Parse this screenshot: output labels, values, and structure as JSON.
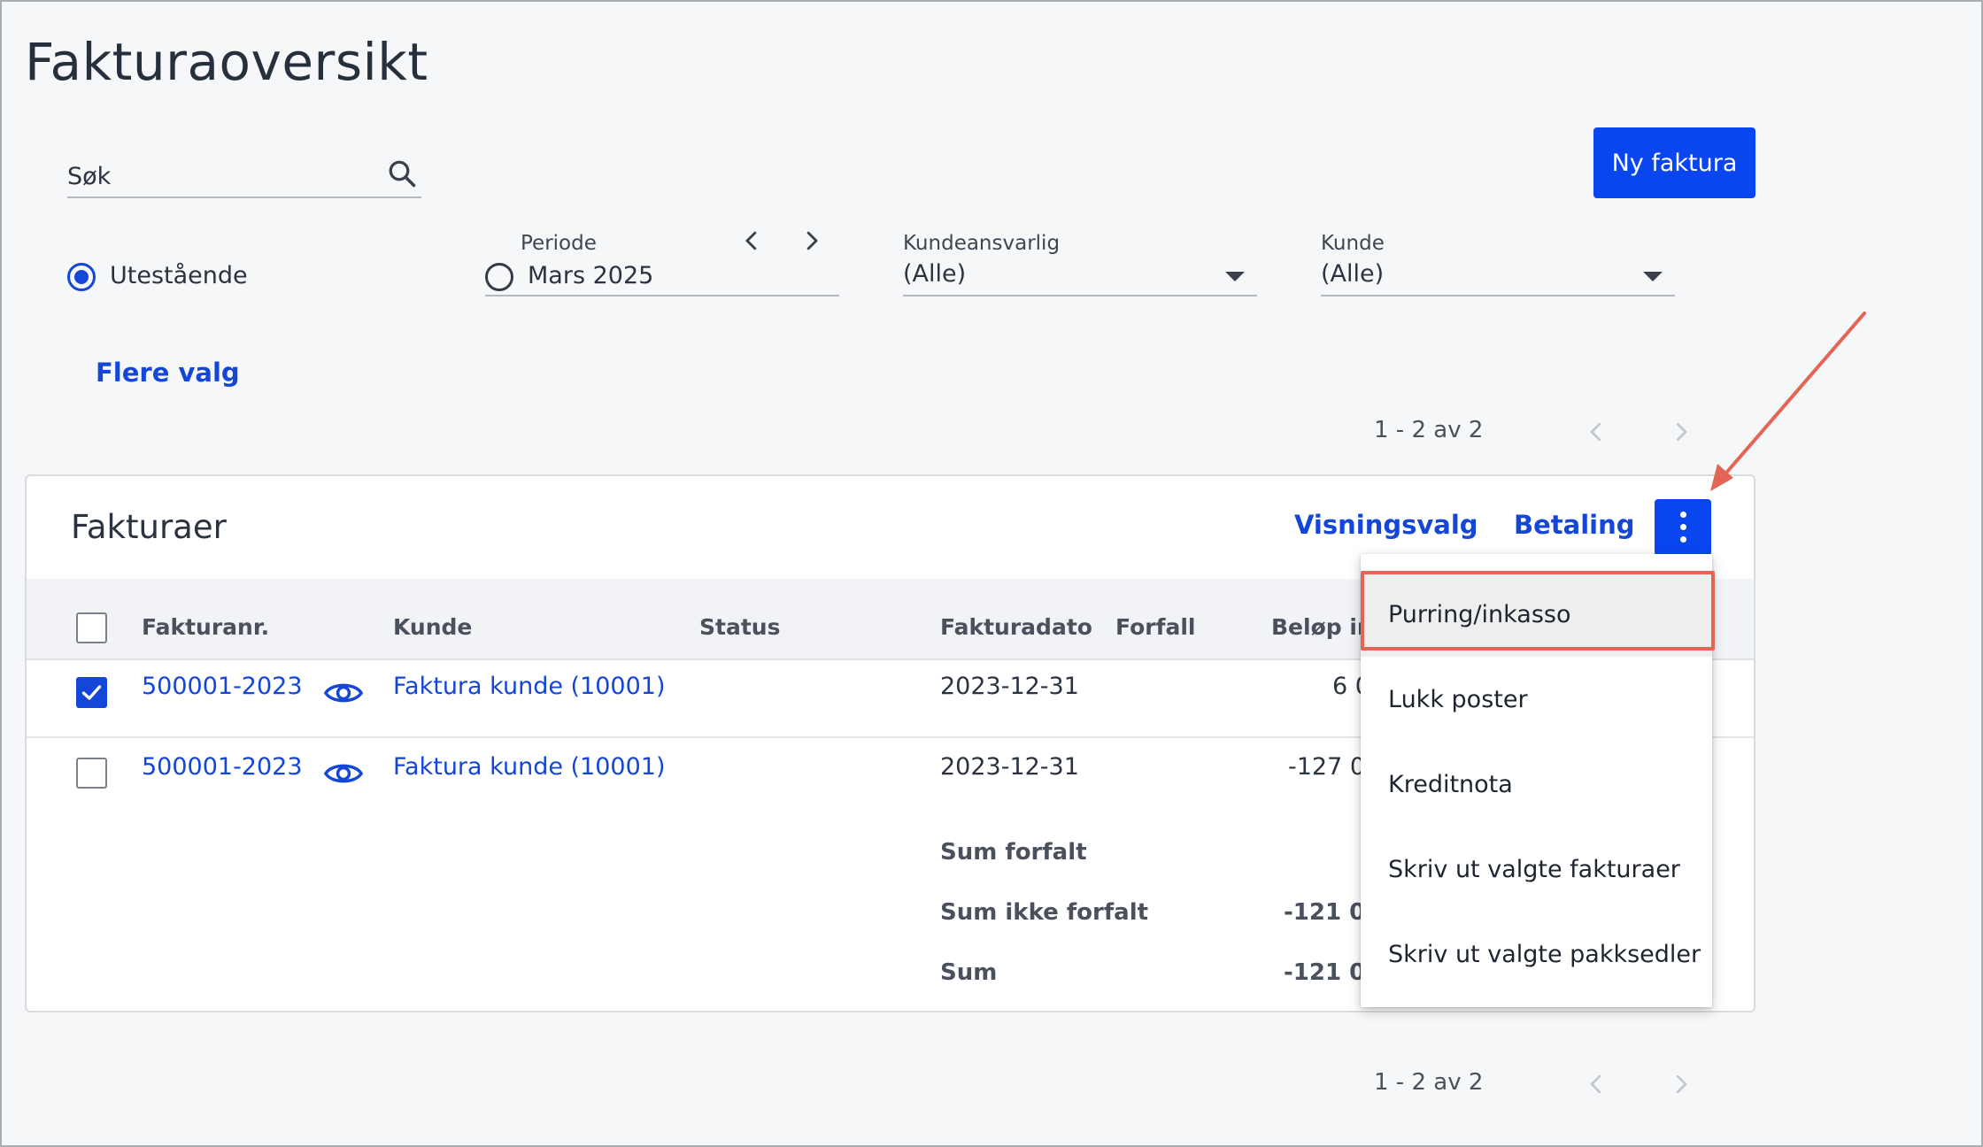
{
  "page": {
    "title": "Fakturaoversikt"
  },
  "search": {
    "label": "Søk"
  },
  "actions": {
    "new_invoice": "Ny faktura"
  },
  "filters": {
    "outstanding_label": "Utestående",
    "period": {
      "label": "Periode",
      "value": "Mars 2025"
    },
    "account_manager": {
      "label": "Kundeansvarlig",
      "value": "(Alle)"
    },
    "customer": {
      "label": "Kunde",
      "value": "(Alle)"
    },
    "more_options": "Flere valg"
  },
  "pagination": {
    "top_text": "1 - 2 av 2",
    "bottom_text": "1 - 2 av 2"
  },
  "card": {
    "title": "Fakturaer",
    "view_options": "Visningsvalg",
    "payment": "Betaling"
  },
  "table": {
    "columns": [
      "Fakturanr.",
      "Kunde",
      "Status",
      "Fakturadato",
      "Forfall",
      "Beløp in"
    ],
    "rows": [
      {
        "checked": true,
        "invoice_no": "500001-2023",
        "customer": "Faktura kunde (10001)",
        "status": "",
        "invoice_date": "2023-12-31",
        "due": "",
        "amount": "6 0"
      },
      {
        "checked": false,
        "invoice_no": "500001-2023",
        "customer": "Faktura kunde (10001)",
        "status": "",
        "invoice_date": "2023-12-31",
        "due": "",
        "amount": "-127 0"
      }
    ],
    "sums": [
      {
        "label": "Sum forfalt",
        "value": ""
      },
      {
        "label": "Sum ikke forfalt",
        "value": "-121 0"
      },
      {
        "label": "Sum",
        "value": "-121 0"
      }
    ]
  },
  "menu": {
    "items": [
      "Purring/inkasso",
      "Lukk poster",
      "Kreditnota",
      "Skriv ut valgte fakturaer",
      "Skriv ut valgte pakksedler"
    ],
    "highlighted_index": 0
  },
  "colors": {
    "primary": "#0a46f0",
    "link": "#1446d8",
    "annotation": "#e36555"
  }
}
